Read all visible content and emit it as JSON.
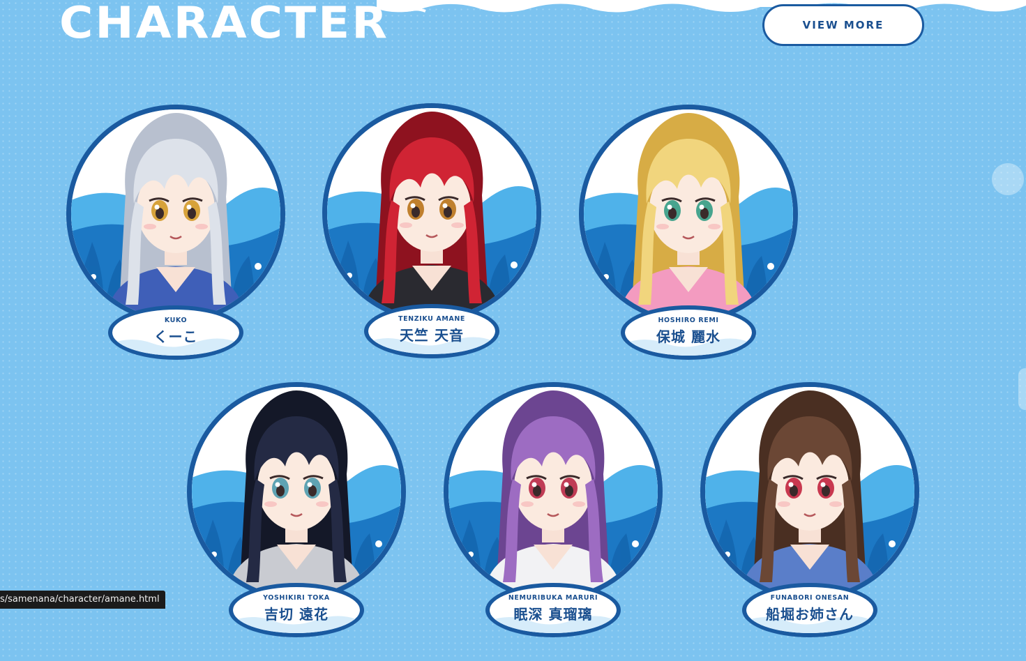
{
  "section": {
    "title": "CHARACTER",
    "view_more_label": "VIEW MORE"
  },
  "characters": [
    {
      "romaji": "KUKO",
      "name": "くーこ",
      "hair": "#dde2ea",
      "hair_shade": "#b8c0cf",
      "eyes": "#d7a23a",
      "outfit": "#3f5fb8"
    },
    {
      "romaji": "TENZIKU AMANE",
      "name": "天竺 天音",
      "hair": "#d02434",
      "hair_shade": "#8e121f",
      "eyes": "#c0802e",
      "outfit": "#2a2a30"
    },
    {
      "romaji": "HOSHIRO REMI",
      "name": "保城 麗水",
      "hair": "#f1d57d",
      "hair_shade": "#d7ac45",
      "eyes": "#47a48e",
      "outfit": "#f39bc0"
    },
    {
      "romaji": "YOSHIKIRI TOKA",
      "name": "吉切 遠花",
      "hair": "#242a44",
      "hair_shade": "#141828",
      "eyes": "#5fa3b3",
      "outfit": "#c9cbd1"
    },
    {
      "romaji": "NEMURIBUKA MARURI",
      "name": "眠深 真瑠璃",
      "hair": "#9d6cc2",
      "hair_shade": "#6c4591",
      "eyes": "#c03c55",
      "outfit": "#f2f2f4"
    },
    {
      "romaji": "FUNABORI ONESAN",
      "name": "船堀お姉さん",
      "hair": "#6b4735",
      "hair_shade": "#4a2f22",
      "eyes": "#c8384f",
      "outfit": "#5a7ec9"
    }
  ],
  "status_bar": {
    "url": "s/samenana/character/amane.html"
  }
}
